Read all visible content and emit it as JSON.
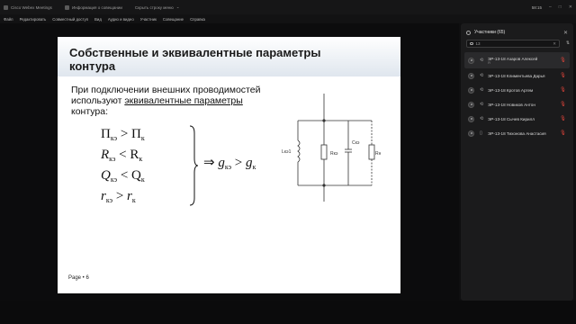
{
  "titlebar": {
    "app_name": "Cisco Webex Meetings",
    "info_label": "Информация о совещании",
    "hide_menu_label": "Скрыть строку меню",
    "time": "58:15"
  },
  "menu": [
    "Файл",
    "Редактировать",
    "Совместный доступ",
    "Вид",
    "Аудио и видео",
    "Участник",
    "Совещание",
    "Справка"
  ],
  "slide": {
    "title": "Собственные и эквивалентные параметры контура",
    "text_prefix": "При подключении внешних проводимостей используют ",
    "text_link": "эквивалентные параметры",
    "text_suffix": " контура:",
    "page": "Page • 6",
    "circuit_labels": {
      "l": "Lкэ1",
      "r1": "Rкэ",
      "c": "Cкэ",
      "r2": "Rн"
    }
  },
  "panel": {
    "title": "Участники (65)",
    "search_value": "13",
    "participants": [
      {
        "name": "ЭР-13-18 Азаров Алексей",
        "sub": "Я"
      },
      {
        "name": "ЭР-13-18 Климентьева Дарья",
        "sub": ""
      },
      {
        "name": "ЭР-13-18 Кротов Артем",
        "sub": ""
      },
      {
        "name": "ЭР-13-18 Новиков Антон",
        "sub": ""
      },
      {
        "name": "ЭР-13-18 Сычев Кирилл",
        "sub": ""
      },
      {
        "name": "ЭР-13-18 Тихонова Анастасия",
        "sub": ""
      }
    ]
  },
  "colors": {
    "muted_mic": "#e0443a",
    "panel_bg": "#1b1b1c",
    "slide_band": "#dfe6ee"
  }
}
